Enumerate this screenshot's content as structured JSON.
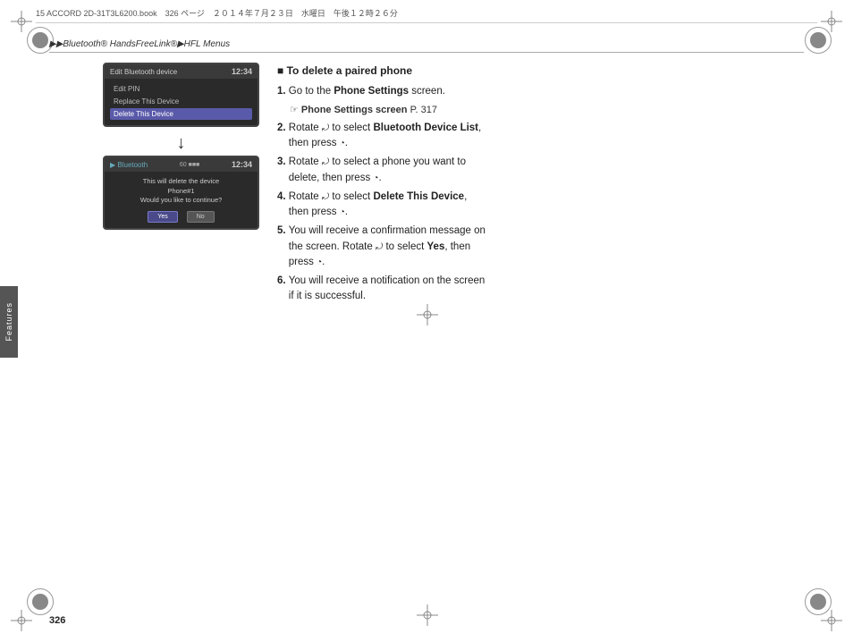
{
  "page": {
    "number": "326",
    "top_file_info": "15 ACCORD 2D-31T3L6200.book　326 ページ　２０１４年７月２３日　水曜日　午後１２時２６分"
  },
  "breadcrumb": {
    "text": "▶▶Bluetooth® HandsFreeLink®▶HFL Menus"
  },
  "side_tab": {
    "label": "Features"
  },
  "screen1": {
    "header_title": "Edit Bluetooth device",
    "clock": "12:34",
    "menu_items": [
      {
        "label": "Edit PIN",
        "state": "normal"
      },
      {
        "label": "Replace This Device",
        "state": "normal"
      },
      {
        "label": "Delete This Device",
        "state": "highlighted"
      }
    ]
  },
  "screen2": {
    "header_bt": "Bluetooth",
    "header_signal": "60 ■■■",
    "clock": "12:34",
    "confirm_line1": "This will delete the device",
    "confirm_line2": "Phone#1",
    "confirm_line3": "Would you like to continue?",
    "btn_yes": "Yes",
    "btn_no": "No"
  },
  "instructions": {
    "section_title": "To delete a paired phone",
    "steps": [
      {
        "num": "1.",
        "text": "Go to the ",
        "bold_part": "Phone Settings",
        "text2": " screen."
      },
      {
        "num": "",
        "sub_note": "Phone Settings screen P. 317"
      },
      {
        "num": "2.",
        "text": "Rotate ",
        "rotate": "↻",
        "text2": " to select ",
        "bold_part": "Bluetooth Device List",
        "text3": ",",
        "text4": "then press ",
        "press": "⊙",
        "text5": "."
      },
      {
        "num": "3.",
        "text": "Rotate ",
        "rotate": "↻",
        "text2": " to select a phone you want to delete, then press ",
        "press": "⊙",
        "text3": "."
      },
      {
        "num": "4.",
        "text": "Rotate ",
        "rotate": "↻",
        "text2": " to select ",
        "bold_part": "Delete This Device",
        "text3": ",",
        "text4": "then press ",
        "press": "⊙",
        "text5": "."
      },
      {
        "num": "5.",
        "text": "You will receive a confirmation message on the screen. Rotate ",
        "rotate": "↻",
        "text2": " to select ",
        "bold_part": "Yes",
        "text3": ", then press ",
        "press": "⊙",
        "text4": "."
      },
      {
        "num": "6.",
        "text": "You will receive a notification on the screen if it is successful."
      }
    ]
  }
}
